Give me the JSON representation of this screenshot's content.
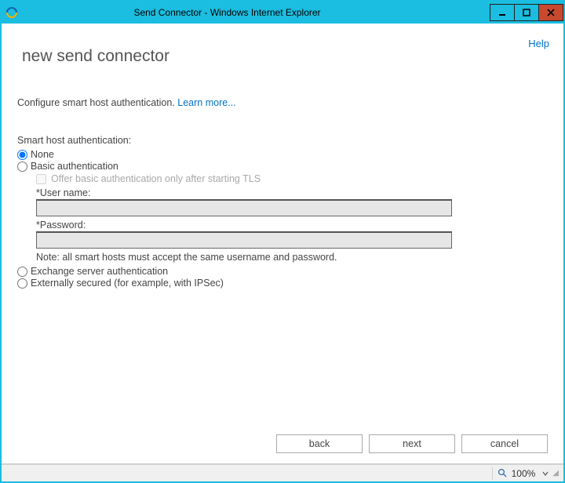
{
  "window": {
    "title": "Send Connector - Windows Internet Explorer"
  },
  "header": {
    "help_label": "Help",
    "page_title": "new send connector"
  },
  "intro": {
    "text": "Configure smart host authentication. ",
    "learn_more": "Learn more..."
  },
  "form": {
    "section_label": "Smart host authentication:",
    "options": {
      "none": "None",
      "basic": "Basic authentication",
      "basic_tls_checkbox": "Offer basic authentication only after starting TLS",
      "username_label": "*User name:",
      "username_value": "",
      "password_label": "*Password:",
      "password_value": "",
      "note": "Note: all smart hosts must accept the same username and password.",
      "exchange": "Exchange server authentication",
      "external": "Externally secured (for example, with IPSec)"
    },
    "selected": "none"
  },
  "buttons": {
    "back": "back",
    "next": "next",
    "cancel": "cancel"
  },
  "statusbar": {
    "zoom": "100%"
  }
}
